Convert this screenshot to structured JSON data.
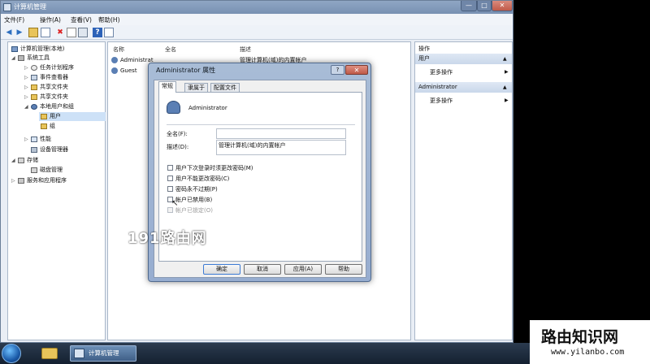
{
  "window": {
    "title": "计算机管理",
    "controls": {
      "minimize": "—",
      "maximize": "□",
      "close": "✕"
    }
  },
  "menu": [
    "文件(F)",
    "操作(A)",
    "查看(V)",
    "帮助(H)"
  ],
  "tree": [
    {
      "label": "计算机管理(本地)",
      "level": 0,
      "twisty": "",
      "icon": "computer-icon"
    },
    {
      "label": "系统工具",
      "level": 1,
      "twisty": "◢",
      "icon": "tools-icon"
    },
    {
      "label": "任务计划程序",
      "level": 2,
      "twisty": "▷",
      "icon": "clock-icon"
    },
    {
      "label": "事件查看器",
      "level": 2,
      "twisty": "▷",
      "icon": "event-icon"
    },
    {
      "label": "共享文件夹",
      "level": 2,
      "twisty": "▷",
      "icon": "folder-icon"
    },
    {
      "label": "共享文件夹",
      "level": 2,
      "twisty": "▷",
      "icon": "share-icon"
    },
    {
      "label": "本地用户和组",
      "level": 2,
      "twisty": "◢",
      "icon": "users-icon"
    },
    {
      "label": "用户",
      "level": 3,
      "twisty": "",
      "icon": "folder-icon"
    },
    {
      "label": "组",
      "level": 3,
      "twisty": "",
      "icon": "folder-icon"
    },
    {
      "label": "性能",
      "level": 2,
      "twisty": "▷",
      "icon": "performance-icon"
    },
    {
      "label": "设备管理器",
      "level": 2,
      "twisty": "",
      "icon": "device-icon"
    },
    {
      "label": "存储",
      "level": 1,
      "twisty": "◢",
      "icon": "storage-icon"
    },
    {
      "label": "磁盘管理",
      "level": 2,
      "twisty": "",
      "icon": "disk-icon"
    },
    {
      "label": "服务和应用程序",
      "level": 1,
      "twisty": "▷",
      "icon": "services-icon"
    }
  ],
  "list": {
    "columns": [
      "名称",
      "全名",
      "描述"
    ],
    "rows": [
      {
        "name": "Administrat",
        "fullname": "",
        "desc": "管理计算机(域)的内置帐户"
      },
      {
        "name": "Guest",
        "fullname": "",
        "desc": ""
      }
    ]
  },
  "actions": {
    "header": "操作",
    "sections": [
      {
        "title": "用户",
        "item": "更多操作",
        "arrow": "▶"
      },
      {
        "title": "Administrator",
        "item": "更多操作",
        "arrow": "▶"
      }
    ],
    "collapse_glyph": "▲"
  },
  "dialog": {
    "title": "Administrator 属性",
    "help": "?",
    "close": "✕",
    "tabs": [
      "常规",
      "隶属于",
      "配置文件"
    ],
    "username": "Administrator",
    "fullname_label": "全名(F):",
    "fullname_value": "",
    "desc_label": "描述(D):",
    "desc_value": "管理计算机(域)的内置帐户",
    "checkboxes": [
      {
        "label": "用户下次登录时须更改密码(M)",
        "checked": false,
        "disabled": false
      },
      {
        "label": "用户不能更改密码(C)",
        "checked": false,
        "disabled": false
      },
      {
        "label": "密码永不过期(P)",
        "checked": false,
        "disabled": false
      },
      {
        "label": "帐户已禁用(B)",
        "checked": false,
        "disabled": false
      },
      {
        "label": "帐户已锁定(O)",
        "checked": false,
        "disabled": true
      }
    ],
    "buttons": {
      "ok": "确定",
      "cancel": "取消",
      "apply": "应用(A)",
      "help": "帮助"
    }
  },
  "watermarks": {
    "center": "191路由网",
    "corner_title": "路由知识网",
    "corner_url": "www.yilanbo.com"
  },
  "taskbar": {
    "mmc_label": "计算机管理"
  }
}
